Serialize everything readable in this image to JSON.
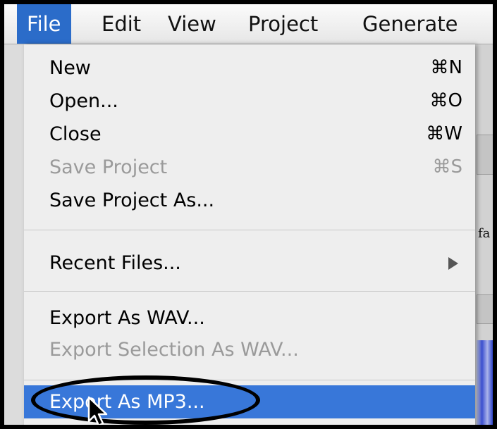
{
  "menubar": {
    "items": [
      {
        "label": "File",
        "active": true
      },
      {
        "label": "Edit"
      },
      {
        "label": "View"
      },
      {
        "label": "Project"
      },
      {
        "label": "Generate"
      }
    ]
  },
  "menu": {
    "items": [
      {
        "label": "New",
        "shortcut": "⌘N"
      },
      {
        "label": "Open...",
        "shortcut": "⌘O"
      },
      {
        "label": "Close",
        "shortcut": "⌘W"
      },
      {
        "label": "Save Project",
        "shortcut": "⌘S",
        "disabled": true
      },
      {
        "label": "Save Project As..."
      },
      {
        "label": "Recent Files..."
      },
      {
        "label": "Export As WAV..."
      },
      {
        "label": "Export Selection As WAV...",
        "disabled": true
      },
      {
        "label": "Export As MP3...",
        "highlighted": true
      }
    ]
  },
  "background": {
    "partial_text": "fa"
  },
  "colors": {
    "highlight": "#3877d9",
    "menubar_active": "#2b6cc9",
    "disabled_text": "#9a9a9a"
  }
}
